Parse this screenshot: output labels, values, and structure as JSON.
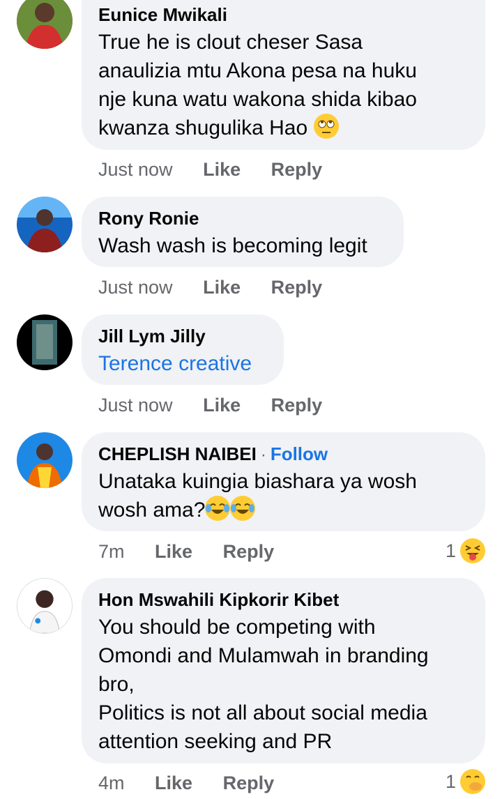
{
  "comments": [
    {
      "name": "Eunice Mwikali",
      "lines": [
        "True he is clout cheser Sasa",
        "anaulizia mtu Akona pesa na huku",
        "nje kuna watu wakona shida kibao",
        "kwanza shugulika Hao"
      ],
      "emoji": "face-with-rolling-eyes",
      "time": "Just now",
      "like": "Like",
      "reply": "Reply"
    },
    {
      "name": "Rony Ronie",
      "lines": [
        "Wash wash is becoming legit"
      ],
      "time": "Just now",
      "like": "Like",
      "reply": "Reply"
    },
    {
      "name": "Jill Lym Jilly",
      "lines": [
        "Terence creative"
      ],
      "time": "Just now",
      "like": "Like",
      "reply": "Reply"
    },
    {
      "name": "CHEPLISH NAIBEI",
      "follow_separator": "·",
      "follow": "Follow",
      "lines": [
        "Unataka kuingia biashara ya wosh",
        "wosh ama?"
      ],
      "emoji": "face-with-tears-of-joy",
      "time": "7m",
      "like": "Like",
      "reply": "Reply",
      "reaction_count": "1",
      "reaction_emoji": "squinting-face-with-tongue"
    },
    {
      "name": "Hon Mswahili Kipkorir Kibet",
      "lines": [
        "You should be competing with",
        "Omondi and Mulamwah in branding",
        "bro,",
        "Politics is not all about social media",
        "attention seeking and PR"
      ],
      "time": "4m",
      "like": "Like",
      "reply": "Reply",
      "reaction_count": "1",
      "reaction_emoji": "face-with-hand-over-mouth"
    }
  ]
}
